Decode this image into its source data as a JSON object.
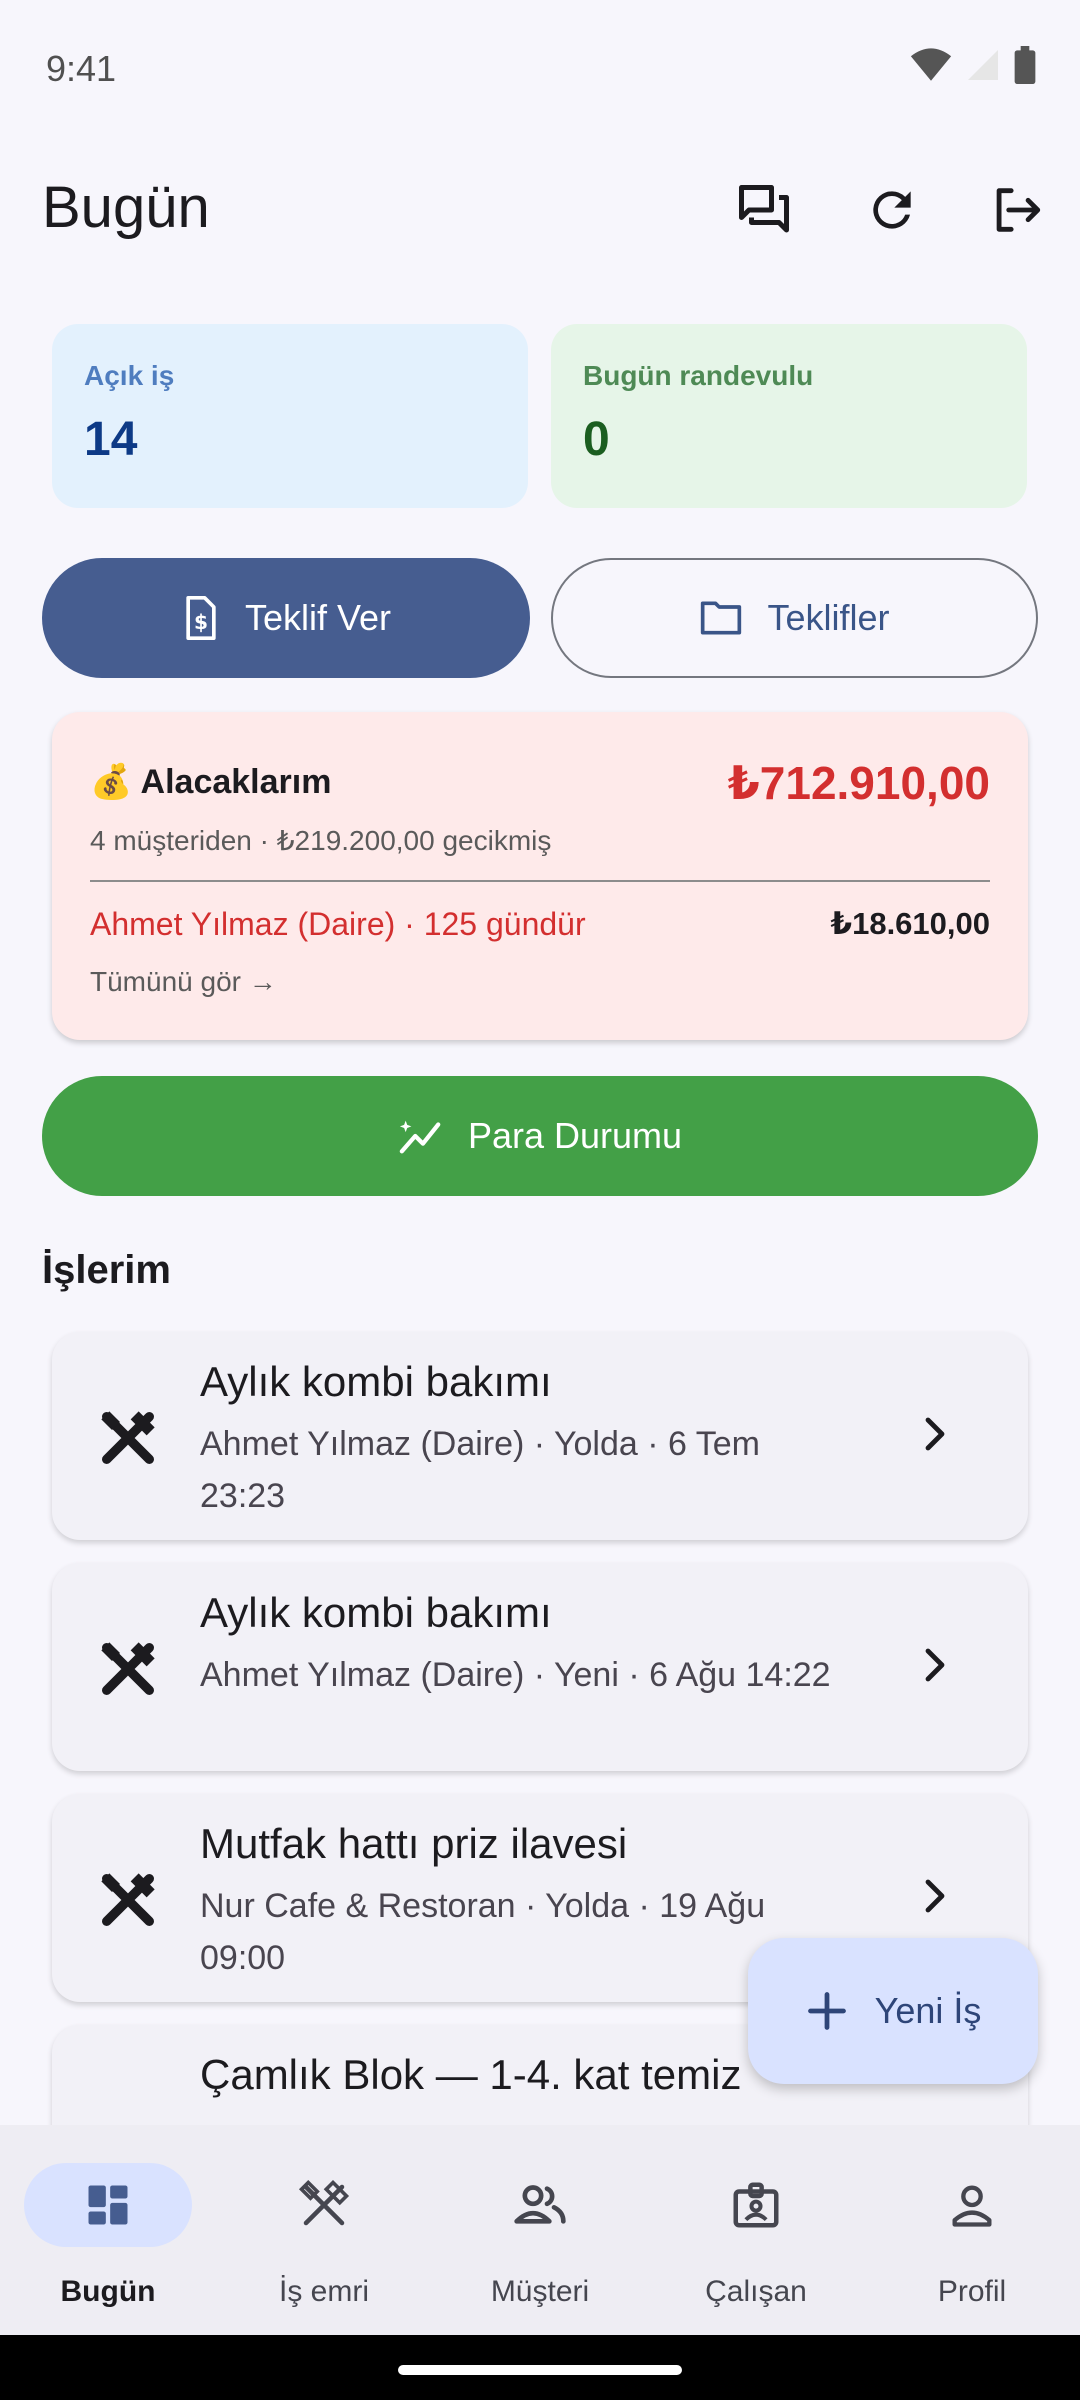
{
  "status_bar": {
    "time": "9:41"
  },
  "header": {
    "title": "Bugün"
  },
  "stats": {
    "open_jobs": {
      "label": "Açık iş",
      "value": "14"
    },
    "today_appointments": {
      "label": "Bugün randevulu",
      "value": "0"
    }
  },
  "actions": {
    "offer_label": "Teklif Ver",
    "offers_label": "Teklifler"
  },
  "receivables": {
    "emoji": "💰",
    "title": "Alacaklarım",
    "total": "₺712.910,00",
    "subtitle": "4 müşteriden · ₺219.200,00 gecikmiş",
    "top_debtor": "Ahmet Yılmaz (Daire) · 125 gündür",
    "top_amount": "₺18.610,00",
    "see_all": "Tümünü gör →"
  },
  "money_button": {
    "label": "Para Durumu"
  },
  "jobs_section": {
    "title": "İşlerim",
    "items": [
      {
        "title": "Aylık kombi bakımı",
        "subtitle": "Ahmet Yılmaz (Daire) · Yolda · 6 Tem 23:23"
      },
      {
        "title": "Aylık kombi bakımı",
        "subtitle": "Ahmet Yılmaz (Daire) · Yeni · 6 Ağu 14:22"
      },
      {
        "title": "Mutfak hattı priz ilavesi",
        "subtitle": "Nur Cafe & Restoran · Yolda · 19 Ağu 09:00"
      },
      {
        "title": "Çamlık Blok — 1-4. kat temiz",
        "subtitle": ""
      }
    ]
  },
  "fab": {
    "label": "Yeni İş"
  },
  "nav": {
    "items": [
      {
        "label": "Bugün",
        "icon": "dashboard-icon"
      },
      {
        "label": "İş emri",
        "icon": "tools-icon"
      },
      {
        "label": "Müşteri",
        "icon": "people-icon"
      },
      {
        "label": "Çalışan",
        "icon": "badge-icon"
      },
      {
        "label": "Profil",
        "icon": "person-icon"
      }
    ]
  },
  "colors": {
    "primary": "#465d90",
    "success": "#43a047",
    "danger": "#d32f2f",
    "open_card_bg": "#e3f1fd",
    "appt_card_bg": "#e6f5e8",
    "receivable_bg": "#feeaea",
    "fab_bg": "#d9e2ff",
    "nav_selected_bg": "#d9e2ff"
  }
}
